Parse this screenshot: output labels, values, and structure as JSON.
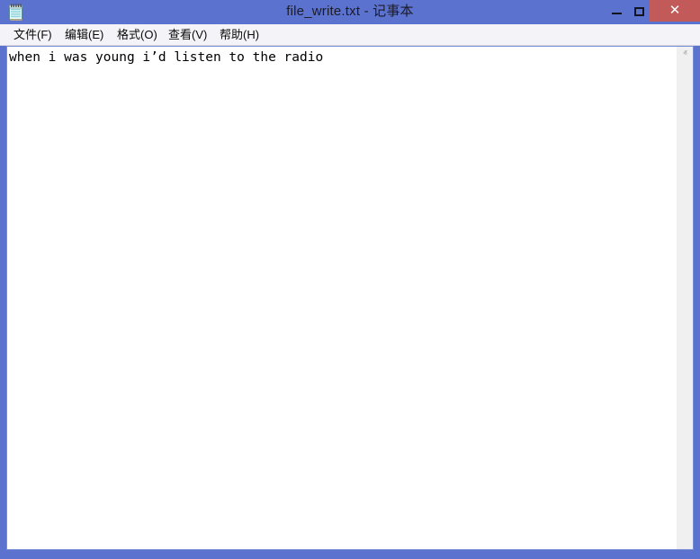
{
  "window": {
    "title": "file_write.txt - 记事本",
    "app_icon": "notepad-icon",
    "frame_color": "#5b72ce",
    "close_button_color": "#c35a5a"
  },
  "titlebar": {
    "minimize_label": "–",
    "maximize_label": "□",
    "close_label": "✕"
  },
  "menubar": {
    "items": [
      {
        "label": "文件(F)",
        "name": "menu-file"
      },
      {
        "label": "编辑(E)",
        "name": "menu-edit"
      },
      {
        "label": "格式(O)",
        "name": "menu-format"
      },
      {
        "label": "查看(V)",
        "name": "menu-view"
      },
      {
        "label": "帮助(H)",
        "name": "menu-help"
      }
    ]
  },
  "editor": {
    "content": "when i was young i’d listen to the radio",
    "background": "#ffffff",
    "text_color": "#000000"
  },
  "scrollbar": {
    "up_arrow": "ⱏ",
    "down_arrow": "ⱟ",
    "track_color": "#f0f0f0"
  }
}
